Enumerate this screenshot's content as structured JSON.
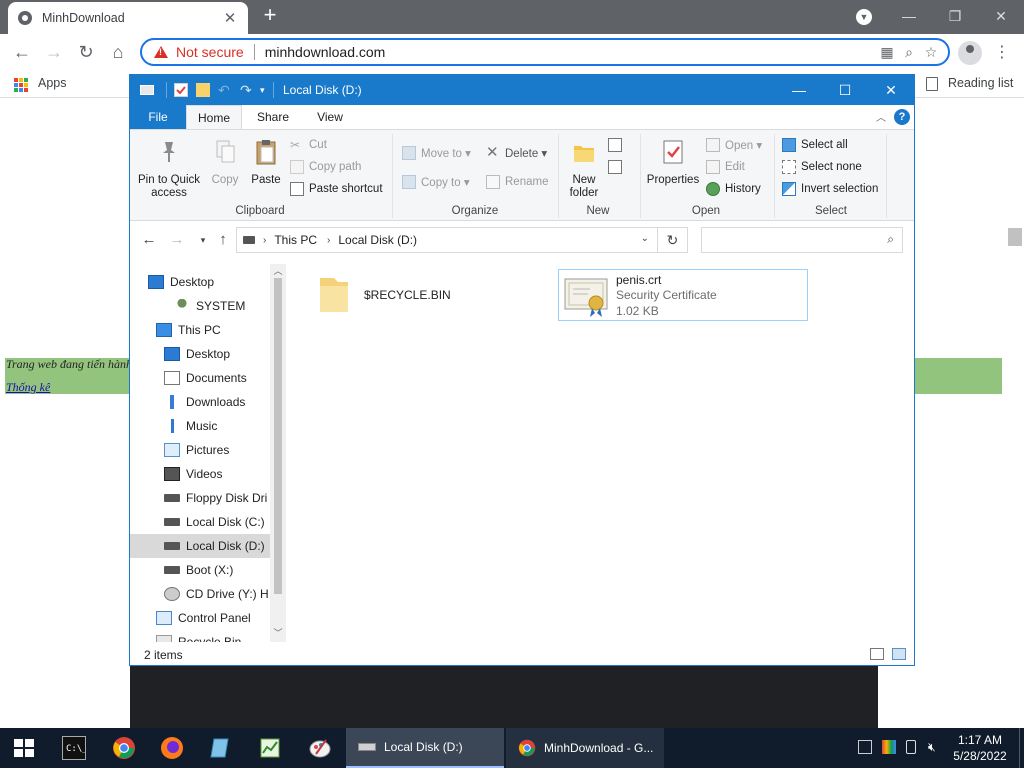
{
  "browser": {
    "tab_title": "MinhDownload",
    "security_label": "Not secure",
    "url": "minhdownload.com",
    "bookmarks_apps": "Apps",
    "reading_list": "Reading list",
    "tab_close": "✕",
    "new_tab": "+",
    "minimize": "—",
    "restore": "❐",
    "close": "✕"
  },
  "page": {
    "banner_text": "Trang web đang tiến hành",
    "link_text": "Thống kê"
  },
  "explorer": {
    "title": "Local Disk (D:)",
    "ribbon_tabs": [
      "File",
      "Home",
      "Share",
      "View"
    ],
    "clipboard": {
      "pin_label_1": "Pin to Quick",
      "pin_label_2": "access",
      "copy": "Copy",
      "paste": "Paste",
      "cut": "Cut",
      "copy_path": "Copy path",
      "paste_shortcut": "Paste shortcut",
      "group": "Clipboard"
    },
    "organize": {
      "move_to": "Move to ▾",
      "copy_to": "Copy to ▾",
      "delete": "Delete ▾",
      "rename": "Rename",
      "group": "Organize"
    },
    "new": {
      "new_folder_1": "New",
      "new_folder_2": "folder",
      "group": "New"
    },
    "open": {
      "properties": "Properties",
      "open": "Open ▾",
      "edit": "Edit",
      "history": "History",
      "group": "Open"
    },
    "select": {
      "select_all": "Select all",
      "select_none": "Select none",
      "invert": "Invert selection",
      "group": "Select"
    },
    "breadcrumb": [
      "This PC",
      "Local Disk (D:)"
    ],
    "search_placeholder": "",
    "nav_items": [
      {
        "label": "Desktop",
        "icon": "desktop-icon"
      },
      {
        "label": "SYSTEM",
        "icon": "user-icon"
      },
      {
        "label": "This PC",
        "icon": "computer-icon"
      },
      {
        "label": "Desktop",
        "icon": "desktop-icon"
      },
      {
        "label": "Documents",
        "icon": "documents-icon"
      },
      {
        "label": "Downloads",
        "icon": "downloads-icon"
      },
      {
        "label": "Music",
        "icon": "music-icon"
      },
      {
        "label": "Pictures",
        "icon": "pictures-icon"
      },
      {
        "label": "Videos",
        "icon": "videos-icon"
      },
      {
        "label": "Floppy Disk Dri",
        "icon": "floppy-icon"
      },
      {
        "label": "Local Disk (C:)",
        "icon": "drive-icon"
      },
      {
        "label": "Local Disk (D:)",
        "icon": "drive-icon",
        "selected": true
      },
      {
        "label": "Boot (X:)",
        "icon": "drive-icon"
      },
      {
        "label": "CD Drive (Y:) H",
        "icon": "cd-drive-icon"
      },
      {
        "label": "Control Panel",
        "icon": "control-panel-icon"
      },
      {
        "label": "Recycle Bin",
        "icon": "recycle-bin-icon"
      }
    ],
    "files": [
      {
        "name": "$RECYCLE.BIN",
        "icon": "folder-icon"
      },
      {
        "name": "penis.crt",
        "type": "Security Certificate",
        "size": "1.02 KB",
        "icon": "certificate-icon"
      }
    ],
    "status": "2 items"
  },
  "taskbar": {
    "windows": [
      {
        "label": "Local Disk (D:)",
        "active": true
      },
      {
        "label": "MinhDownload - G...",
        "active": false
      }
    ],
    "time": "1:17 AM",
    "date": "5/28/2022"
  },
  "colors": {
    "explorer_accent": "#1979ca",
    "chrome_frame": "#5f6368",
    "security_warning": "#d93025",
    "page_banner": "#93c47d",
    "taskbar": "#101c2c"
  }
}
